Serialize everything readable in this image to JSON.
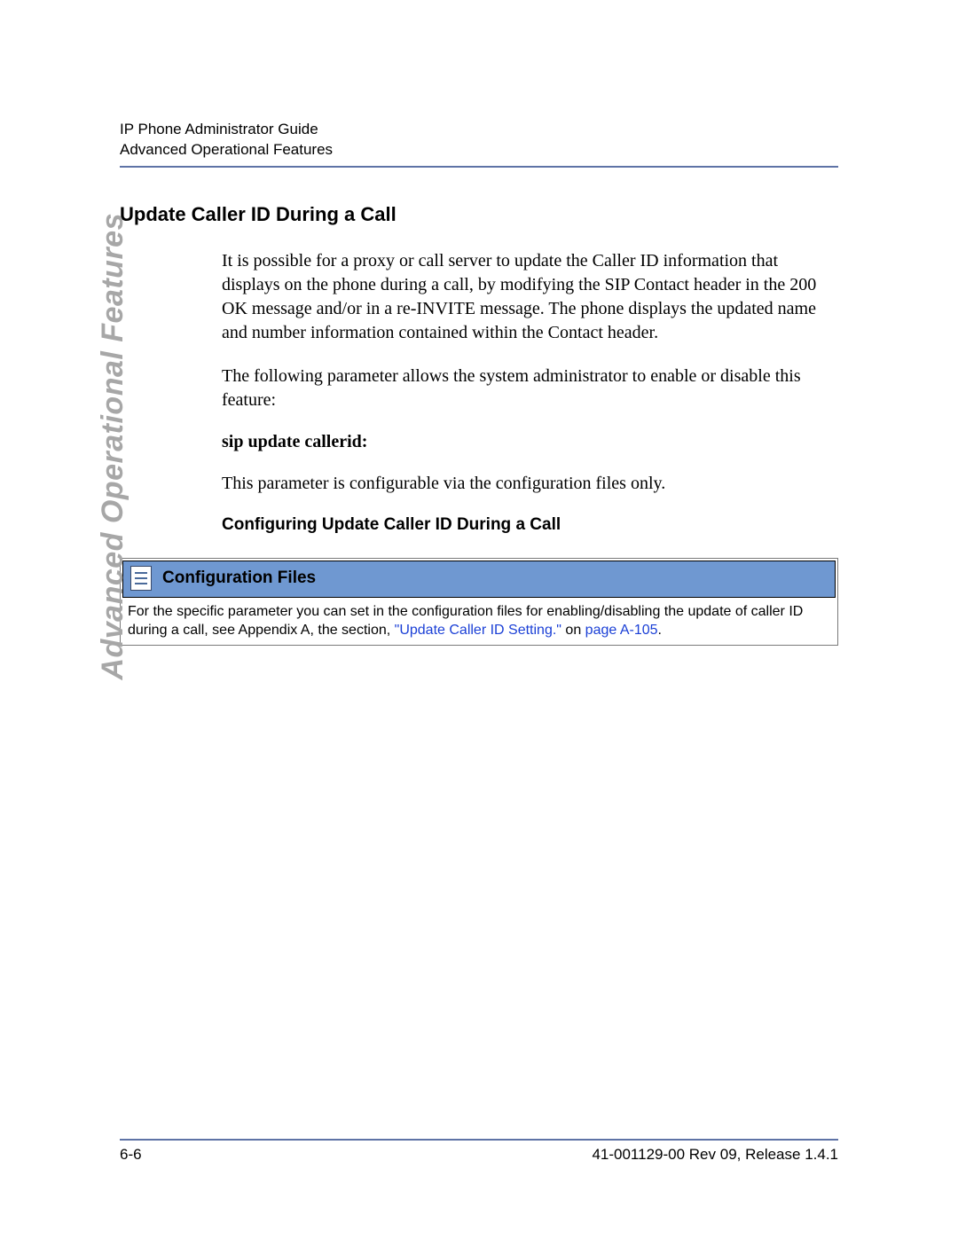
{
  "header": {
    "line1": "IP Phone Administrator Guide",
    "line2": "Advanced Operational Features"
  },
  "side_tab": "Advanced Operational Features",
  "section": {
    "title": "Update Caller ID During a Call",
    "para1": "It is possible for a proxy or call server to update the Caller ID information that displays on the phone during a call, by modifying the SIP Contact header in the 200 OK message and/or in a re-INVITE message.  The phone displays the updated name and number information contained within the Contact header.",
    "para2": "The following parameter allows the system administrator to enable or disable this feature:",
    "param_name": "sip update callerid:",
    "para3": "This parameter is configurable via the configuration files only.",
    "subheading": "Configuring Update Caller ID During a Call"
  },
  "config_box": {
    "title": "Configuration Files",
    "body_prefix": "For the specific parameter you can set in the configuration files for enabling/disabling the update of caller ID during a call, see Appendix A, the section, ",
    "link1": "\"Update Caller ID Setting.\"",
    "body_mid": " on ",
    "link2": "page A-105",
    "body_suffix": "."
  },
  "footer": {
    "page_num": "6-6",
    "doc_info": "41-001129-00 Rev 09, Release 1.4.1"
  }
}
